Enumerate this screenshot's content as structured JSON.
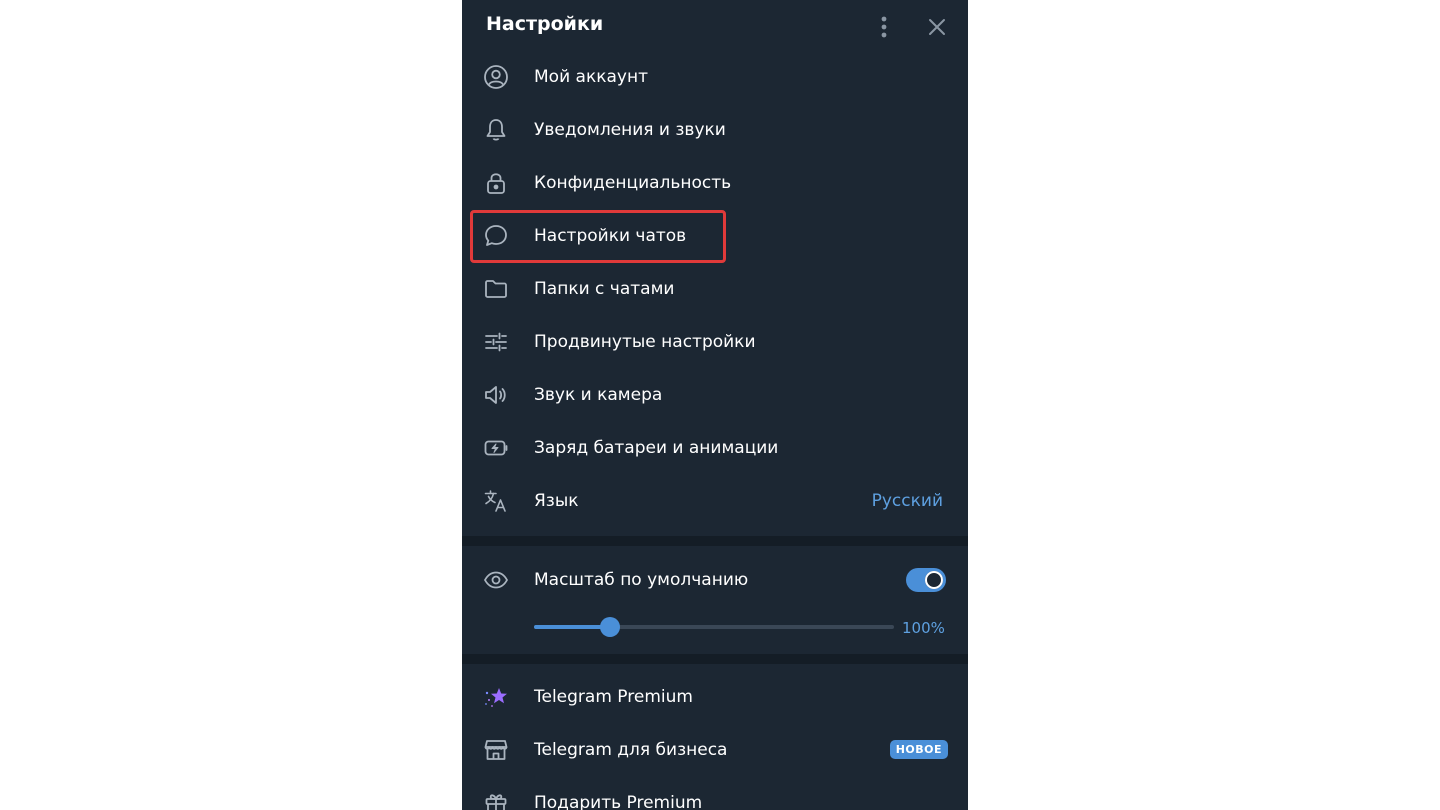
{
  "header": {
    "title": "Настройки",
    "more_icon": "more-vertical-icon",
    "close_icon": "close-icon"
  },
  "menu": [
    {
      "label": "Мой аккаунт",
      "icon": "account-circle-icon"
    },
    {
      "label": "Уведомления и звуки",
      "icon": "bell-icon"
    },
    {
      "label": "Конфиденциальность",
      "icon": "lock-icon"
    },
    {
      "label": "Настройки чатов",
      "icon": "chat-bubble-icon",
      "highlighted": true
    },
    {
      "label": "Папки с чатами",
      "icon": "folder-icon"
    },
    {
      "label": "Продвинутые настройки",
      "icon": "sliders-icon"
    },
    {
      "label": "Звук и камера",
      "icon": "speaker-icon"
    },
    {
      "label": "Заряд батареи и анимации",
      "icon": "battery-bolt-icon"
    },
    {
      "label": "Язык",
      "icon": "translate-icon",
      "value": "Русский"
    }
  ],
  "scale": {
    "label": "Масштаб по умолчанию",
    "icon": "eye-icon",
    "toggle_on": true,
    "slider_fraction": 0.21,
    "value_text": "100%"
  },
  "menu2": [
    {
      "label": "Telegram Premium",
      "icon": "premium-star-icon"
    },
    {
      "label": "Telegram для бизнеса",
      "icon": "store-icon",
      "badge": "НОВОЕ"
    },
    {
      "label": "Подарить Premium",
      "icon": "gift-icon"
    }
  ],
  "colors": {
    "panel_bg": "#1c2733",
    "accent": "#4a8fd8",
    "link": "#5ea0e0",
    "highlight_border": "#e03a3a"
  }
}
